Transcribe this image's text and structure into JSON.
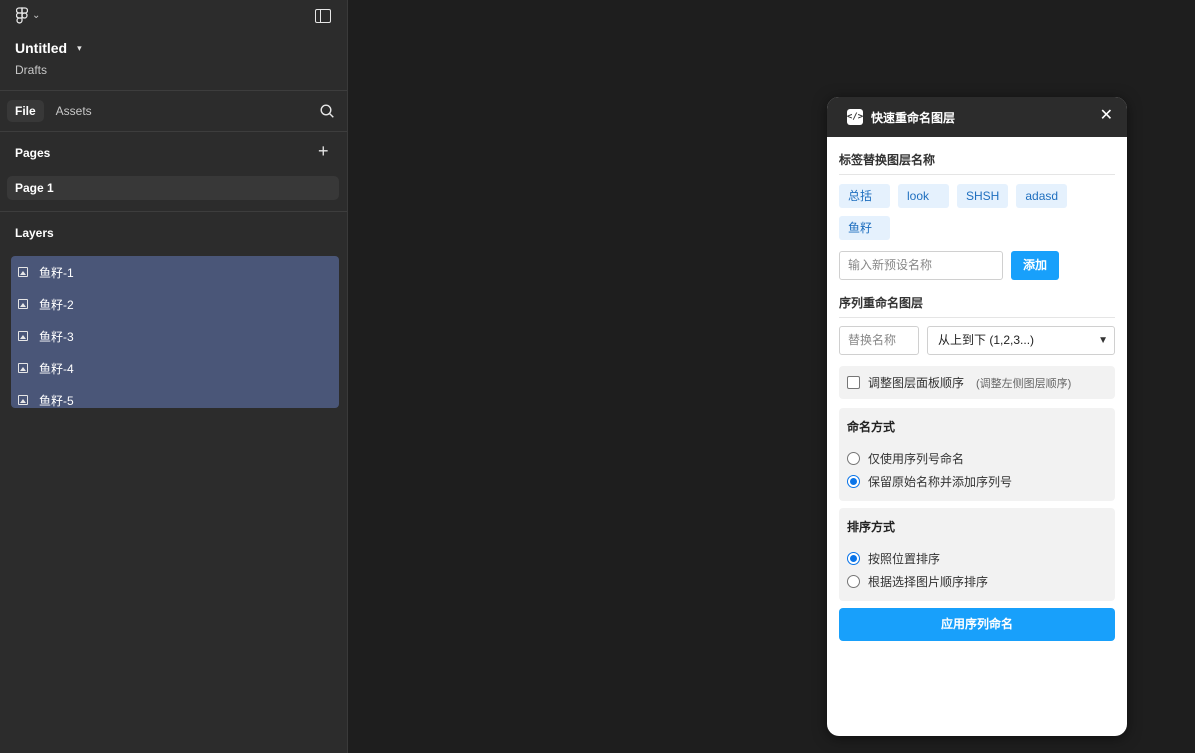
{
  "sidebar": {
    "file_title": "Untitled",
    "file_subtitle": "Drafts",
    "tabs": [
      {
        "label": "File"
      },
      {
        "label": "Assets"
      }
    ],
    "pages_label": "Pages",
    "pages": [
      {
        "label": "Page 1"
      }
    ],
    "layers_label": "Layers",
    "layers": [
      {
        "label": "鱼籽-1"
      },
      {
        "label": "鱼籽-2"
      },
      {
        "label": "鱼籽-3"
      },
      {
        "label": "鱼籽-4"
      },
      {
        "label": "鱼籽-5"
      }
    ],
    "colors": {
      "background": "#2c2c2c",
      "selection": "#4a5678"
    }
  },
  "plugin": {
    "icon_glyph": "</>",
    "title": "快速重命名图层",
    "close_glyph": "✕",
    "tag_section_title": "标签替换图层名称",
    "tags": [
      {
        "label": "总括"
      },
      {
        "label": "look"
      },
      {
        "label": "SHSH"
      },
      {
        "label": "adasd"
      },
      {
        "label": "鱼籽"
      }
    ],
    "new_tag_placeholder": "输入新预设名称",
    "add_button": "添加",
    "sequence_section_title": "序列重命名图层",
    "replace_placeholder": "替换名称",
    "order_select_value": "从上到下 (1,2,3...)",
    "adjust_panel_label": "调整图层面板顺序",
    "adjust_panel_hint": "(调整左侧图层顺序)",
    "adjust_panel_checked": false,
    "naming_title": "命名方式",
    "naming_options": [
      {
        "label": "仅使用序列号命名",
        "checked": false
      },
      {
        "label": "保留原始名称并添加序列号",
        "checked": true
      }
    ],
    "sort_title": "排序方式",
    "sort_options": [
      {
        "label": "按照位置排序",
        "checked": true
      },
      {
        "label": "根据选择图片顺序排序",
        "checked": false
      }
    ],
    "apply_button": "应用序列命名",
    "colors": {
      "accent": "#18a0fb",
      "chip_bg": "#e5f1fd",
      "chip_text": "#1f6fbf",
      "header_bg": "#2c2c2c"
    }
  }
}
